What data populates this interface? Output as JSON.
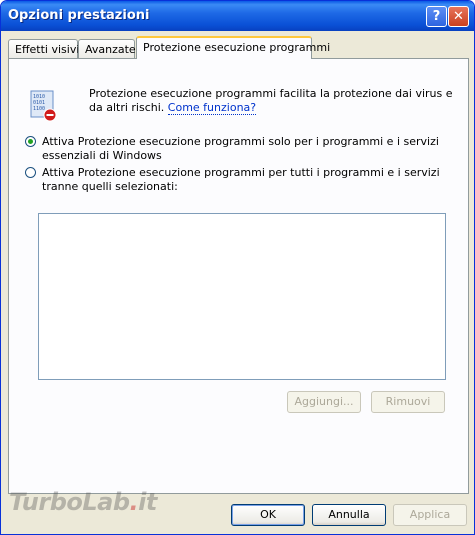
{
  "window": {
    "title": "Opzioni prestazioni",
    "help_label": "?",
    "close_label": "✕"
  },
  "tabs": [
    {
      "label": "Effetti visivi",
      "active": false
    },
    {
      "label": "Avanzate",
      "active": false
    },
    {
      "label": "Protezione esecuzione programmi",
      "active": true
    }
  ],
  "panel": {
    "icon": "dep-shield-icon",
    "description": "Protezione esecuzione programmi facilita la protezione dai virus e da altri rischi.",
    "link": "Come funziona?",
    "options": [
      {
        "label": "Attiva Protezione esecuzione programmi solo per i programmi e i servizi essenziali di Windows",
        "checked": true
      },
      {
        "label": "Attiva Protezione esecuzione programmi per tutti i programmi e i servizi tranne quelli selezionati:",
        "checked": false
      }
    ],
    "add_button": "Aggiungi...",
    "remove_button": "Rimuovi"
  },
  "footer": {
    "ok": "OK",
    "cancel": "Annulla",
    "apply": "Applica"
  },
  "watermark": {
    "part1": "TurboLab",
    "dot": ".",
    "part2": "it"
  },
  "colors": {
    "title_bar": "#0a50d6",
    "dialog_bg": "#ece9d8",
    "link": "#0033cc",
    "radio_checked": "#21a121"
  }
}
